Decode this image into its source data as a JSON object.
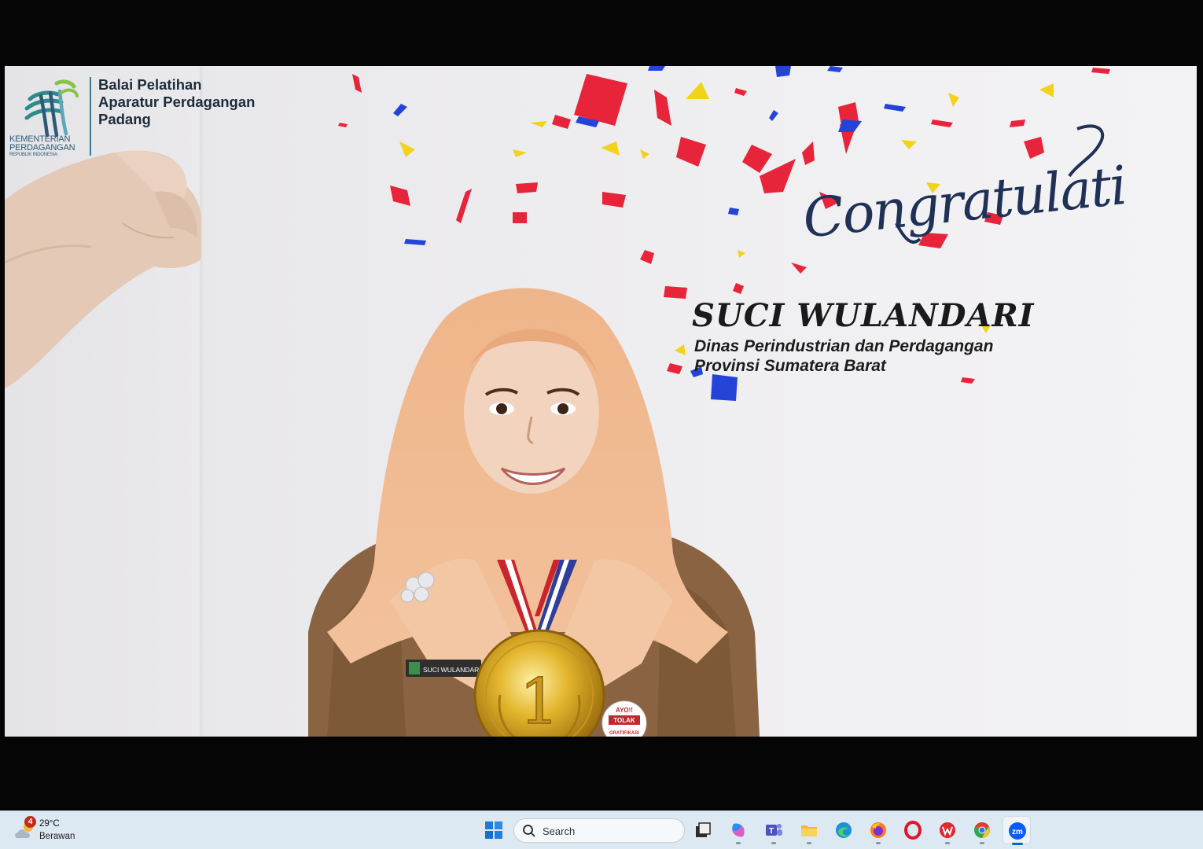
{
  "presentation": {
    "institute_lines": [
      "Balai Pelatihan",
      "Aparatur Perdagangan",
      "Padang"
    ],
    "ministry_lines": [
      "KEMENTERIAN",
      "PERDAGANGAN"
    ],
    "ministry_sub": "REPUBLIK INDONESIA",
    "greeting": "Congratulations",
    "winner_name": "SUCI WULANDARI",
    "winner_org_lines": [
      "Dinas Perindustrian dan Perdagangan",
      "Provinsi Sumatera Barat"
    ],
    "name_tag": "SUCI WULANDARI",
    "badge_lines": [
      "AYO!!",
      "TOLAK",
      "GRATIFIKASI"
    ],
    "medal_rank": "1"
  },
  "taskbar": {
    "weather": {
      "badge_count": "4",
      "temperature": "29°C",
      "condition": "Berawan",
      "icon": "partly-cloudy-icon"
    },
    "search_placeholder": "Search",
    "apps": [
      {
        "icon": "task-view-icon"
      },
      {
        "icon": "copilot-icon"
      },
      {
        "icon": "teams-icon"
      },
      {
        "icon": "file-explorer-icon"
      },
      {
        "icon": "edge-icon"
      },
      {
        "icon": "firefox-icon"
      },
      {
        "icon": "opera-icon"
      },
      {
        "icon": "wps-office-icon"
      },
      {
        "icon": "chrome-icon"
      },
      {
        "icon": "zoom-icon"
      }
    ]
  },
  "colors": {
    "taskbar_bg": "#dce8f2",
    "confetti_red": "#e8243a",
    "confetti_blue": "#2444d8",
    "confetti_yellow": "#f2d21a",
    "script_navy": "#1f3156",
    "logo_teal": "#2f8a8c"
  }
}
